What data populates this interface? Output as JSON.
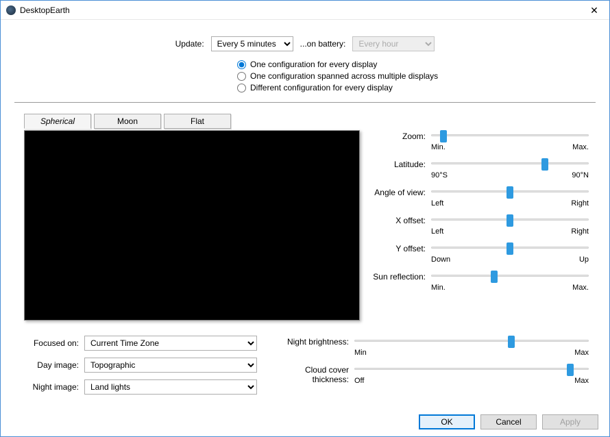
{
  "window": {
    "title": "DesktopEarth"
  },
  "top": {
    "update_label": "Update:",
    "update_value": "Every 5 minutes",
    "battery_label": "...on battery:",
    "battery_value": "Every hour"
  },
  "config_radio": {
    "opt1": "One configuration for every display",
    "opt2": "One configuration spanned across multiple displays",
    "opt3": "Different configuration for every display"
  },
  "tabs": {
    "spherical": "Spherical",
    "moon": "Moon",
    "flat": "Flat"
  },
  "sliders": {
    "zoom": {
      "label": "Zoom:",
      "min": "Min.",
      "max": "Max.",
      "pos": 8
    },
    "latitude": {
      "label": "Latitude:",
      "min": "90°S",
      "max": "90°N",
      "pos": 72
    },
    "angle": {
      "label": "Angle of view:",
      "min": "Left",
      "max": "Right",
      "pos": 50
    },
    "xoffset": {
      "label": "X offset:",
      "min": "Left",
      "max": "Right",
      "pos": 50
    },
    "yoffset": {
      "label": "Y offset:",
      "min": "Down",
      "max": "Up",
      "pos": 50
    },
    "sun": {
      "label": "Sun reflection:",
      "min": "Min.",
      "max": "Max.",
      "pos": 40
    },
    "night": {
      "label": "Night brightness:",
      "min": "Min",
      "max": "Max",
      "pos": 67
    },
    "cloud": {
      "label": "Cloud cover thickness:",
      "min": "Off",
      "max": "Max",
      "pos": 92
    }
  },
  "selects": {
    "focused_label": "Focused on:",
    "focused_value": "Current Time Zone",
    "day_label": "Day image:",
    "day_value": "Topographic",
    "night_label": "Night image:",
    "night_value": "Land lights"
  },
  "buttons": {
    "ok": "OK",
    "cancel": "Cancel",
    "apply": "Apply"
  }
}
